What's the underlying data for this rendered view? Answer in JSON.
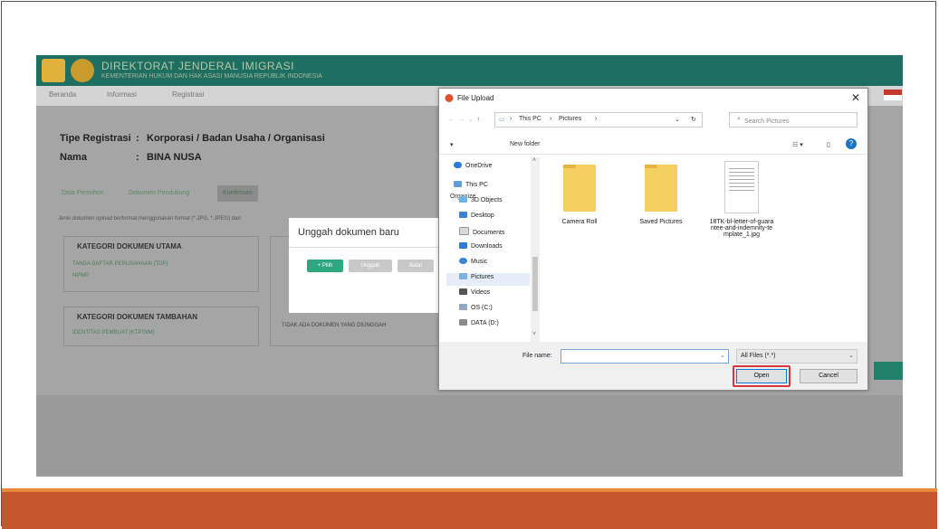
{
  "header": {
    "title": "DIREKTORAT JENDERAL IMIGRASI",
    "subtitle": "KEMENTERIAN HUKUM DAN HAK ASASI MANUSIA REPUBLIK INDONESIA"
  },
  "nav": {
    "items": [
      "Beranda",
      "Informasi",
      "Registrasi"
    ]
  },
  "info": {
    "tipe_label": "Tipe Registrasi",
    "tipe_value": "Korporasi / Badan Usaha / Organisasi",
    "nama_label": "Nama",
    "nama_value": "BINA NUSA"
  },
  "tabs": [
    "Data Pemohon",
    "Dokumen Pendukung",
    "Konfirmasi"
  ],
  "note": "Jenis dokumen upload berformat menggunakan format (*.JPG, *.JPEG) dan",
  "box_main": {
    "title": "KATEGORI DOKUMEN UTAMA",
    "links": [
      "TANDA DAFTAR PERUSAHAAN (TDP)",
      "NPWP"
    ]
  },
  "box_extra": {
    "title": "KATEGORI DOKUMEN TAMBAHAN",
    "links": [
      "IDENTITAS PEMBUAT (KTP/SIM)"
    ]
  },
  "box_right_text": "TIDAK ADA DOKUMEN YANG DIUNGGAH",
  "modal": {
    "title": "Unggah dokumen baru",
    "buttons": [
      "+ Pilih",
      "Unggah",
      "Batal"
    ]
  },
  "dialog": {
    "title": "File Upload",
    "path": [
      "This PC",
      "Pictures"
    ],
    "search_placeholder": "Search Pictures",
    "toolbar": {
      "organize": "Organize",
      "new_folder": "New folder"
    },
    "nav_items": [
      {
        "label": "OneDrive",
        "icon": "cloud-icon"
      },
      {
        "label": "This PC",
        "icon": "pc-icon"
      },
      {
        "label": "3D Objects",
        "icon": "cube-icon"
      },
      {
        "label": "Desktop",
        "icon": "desktop-icon"
      },
      {
        "label": "Documents",
        "icon": "documents-icon"
      },
      {
        "label": "Downloads",
        "icon": "download-icon"
      },
      {
        "label": "Music",
        "icon": "music-icon"
      },
      {
        "label": "Pictures",
        "icon": "pictures-icon"
      },
      {
        "label": "Videos",
        "icon": "video-icon"
      },
      {
        "label": "OS (C:)",
        "icon": "drive-icon"
      },
      {
        "label": "DATA (D:)",
        "icon": "drive-icon"
      }
    ],
    "selected_nav": "Pictures",
    "files": [
      {
        "name": "Camera Roll",
        "type": "folder"
      },
      {
        "name": "Saved Pictures",
        "type": "folder"
      },
      {
        "name": "18TK-bl-letter-of-guarantee-and-indemnity-template_1.jpg",
        "type": "image"
      }
    ],
    "file_name_label": "File name:",
    "file_name_value": "",
    "filter": "All Files (*.*)",
    "open_label": "Open",
    "cancel_label": "Cancel"
  },
  "colors": {
    "header": "#1e6e62",
    "bottom_band": "#c5572e",
    "highlight": "#d9363e"
  }
}
